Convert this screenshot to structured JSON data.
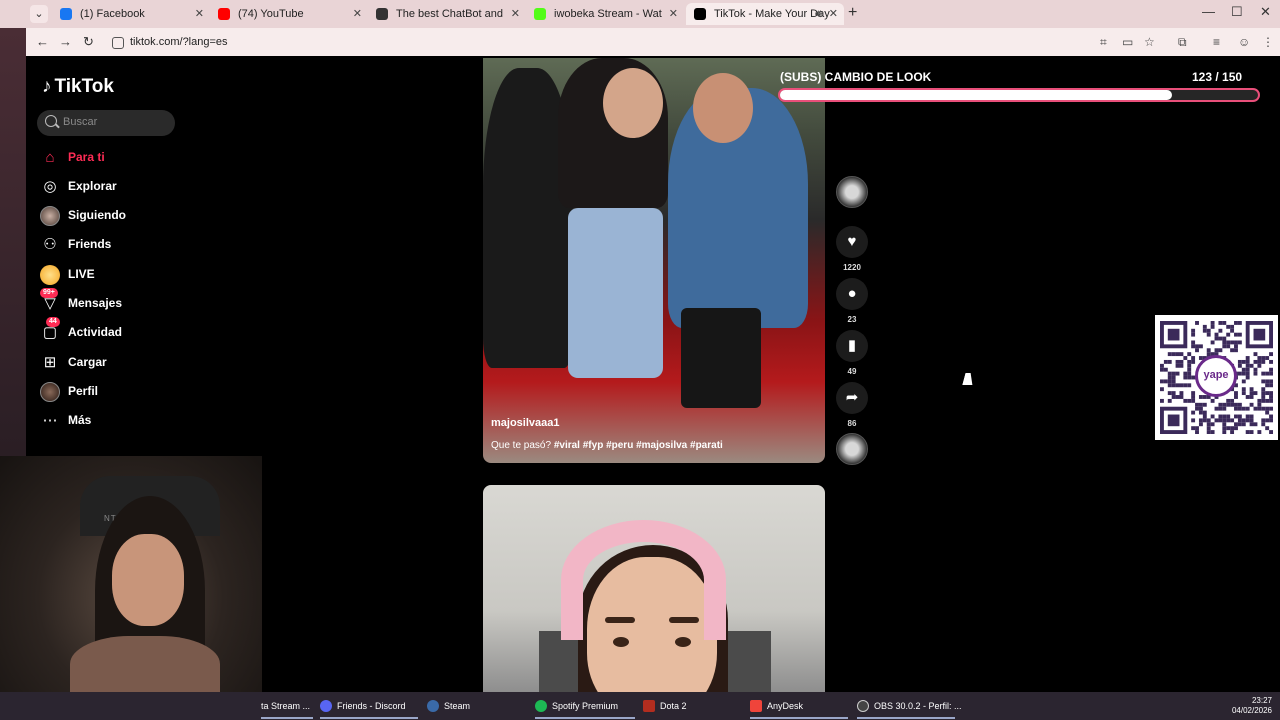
{
  "browser": {
    "tabs": [
      {
        "label": "(1) Facebook",
        "color": "#1877f2"
      },
      {
        "label": "(74) YouTube",
        "color": "#ff0000"
      },
      {
        "label": "The best ChatBot and Widgets",
        "color": "#333333"
      },
      {
        "label": "iwobeka Stream - Watch Live o",
        "color": "#53fc18"
      },
      {
        "label": "TikTok - Make Your Day",
        "color": "#000000"
      }
    ],
    "url": "tiktok.com/?lang=es"
  },
  "tiktok": {
    "logo": "TikTok",
    "search_placeholder": "Buscar",
    "nav": [
      {
        "label": "Para ti",
        "icon": "home-icon"
      },
      {
        "label": "Explorar",
        "icon": "compass-icon"
      },
      {
        "label": "Siguiendo",
        "icon": "avatar-icon"
      },
      {
        "label": "Friends",
        "icon": "people-icon"
      },
      {
        "label": "LIVE",
        "icon": "live-icon"
      },
      {
        "label": "Mensajes",
        "icon": "message-icon",
        "badge": "99+"
      },
      {
        "label": "Actividad",
        "icon": "inbox-icon",
        "badge": "44"
      },
      {
        "label": "Cargar",
        "icon": "upload-icon"
      },
      {
        "label": "Perfil",
        "icon": "profile-icon"
      },
      {
        "label": "Más",
        "icon": "more-icon"
      }
    ],
    "video": {
      "username": "majosilvaaa1",
      "caption_text": "Que te pasó?",
      "hashtags": "#viral #fyp #peru #majosilva #parati"
    },
    "actions": {
      "likes": "1220",
      "comments": "23",
      "saves": "49",
      "shares": "86"
    }
  },
  "overlay": {
    "goal_title": "(SUBS) CAMBIO DE LOOK",
    "goal_count": "123  / 150",
    "goal_progress": 0.82,
    "qr_label": "yape"
  },
  "webcam": {
    "brand": "NTRYX"
  },
  "taskbar": {
    "items": [
      {
        "label": "ta Stream ...",
        "color": "#53fc18"
      },
      {
        "label": "Friends - Discord",
        "color": "#5865f2"
      },
      {
        "label": "Steam",
        "color": "#1b2838"
      },
      {
        "label": "Spotify Premium",
        "color": "#1db954"
      },
      {
        "label": "Dota 2",
        "color": "#b22d1f"
      },
      {
        "label": "AnyDesk",
        "color": "#ef443b"
      },
      {
        "label": "OBS 30.0.2 - Perfil: ...",
        "color": "#444444"
      }
    ],
    "time": "23:27",
    "date": "04/02/2026"
  }
}
